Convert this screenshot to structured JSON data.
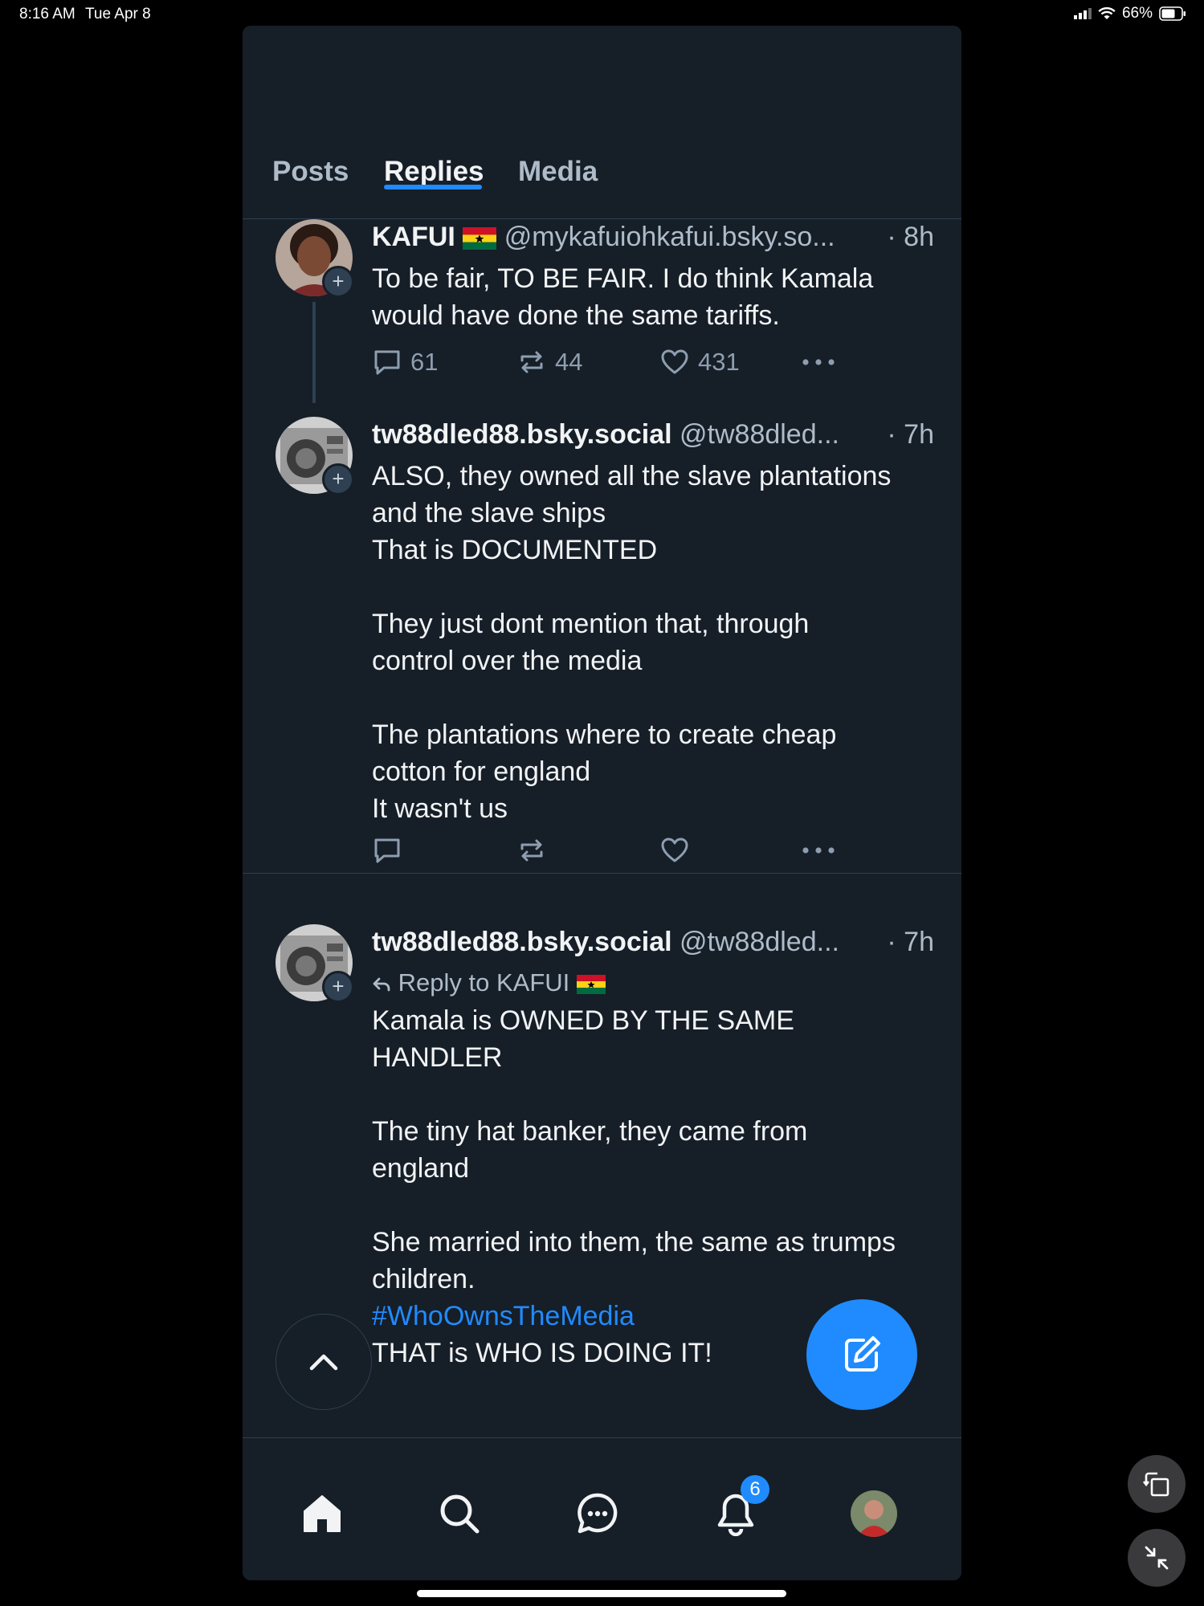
{
  "status_bar": {
    "time": "8:16 AM",
    "date": "Tue Apr 8",
    "battery": "66%"
  },
  "tabs": [
    {
      "label": "Posts",
      "active": false
    },
    {
      "label": "Replies",
      "active": true
    },
    {
      "label": "Media",
      "active": false
    }
  ],
  "posts": [
    {
      "display_name": "KAFUI",
      "handle": "@mykafuiohkafui.bsky.so...",
      "time": "· 8h",
      "text": "To be fair, TO BE FAIR. I do think Kamala would have done the same tariffs.",
      "replies": "61",
      "reposts": "44",
      "likes": "431"
    },
    {
      "display_name": "tw88dled88.bsky.social",
      "handle": "@tw88dled...",
      "time": "· 7h",
      "text": "ALSO, they owned all the slave plantations\nand the slave ships\nThat is DOCUMENTED\n\nThey just dont mention that, through\ncontrol over the media\n\nThe plantations where to create cheap\ncotton for england\nIt wasn't us"
    },
    {
      "display_name": "tw88dled88.bsky.social",
      "handle": "@tw88dled...",
      "time": "· 7h",
      "reply_to": "Reply to KAFUI",
      "text": "Kamala is OWNED BY THE SAME\nHANDLER\n\nThe tiny hat banker, they came from\nengland\n\nShe married into them, the same as trumps\nchildren.\n\nTHAT is WHO IS DOING IT!",
      "hashtag": "#WhoOwnsTheMedia"
    }
  ],
  "nav": {
    "items": [
      "home-icon",
      "search-icon",
      "chat-icon",
      "bell-icon",
      "profile-avatar"
    ],
    "notification_count": "6"
  },
  "colors": {
    "background": "#161e27",
    "accent": "#208bfe",
    "muted": "#aebbc9",
    "border": "#2e4052"
  }
}
